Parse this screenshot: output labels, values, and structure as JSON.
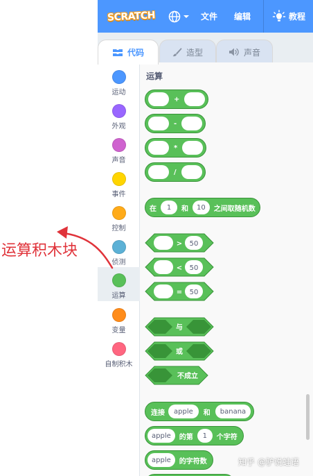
{
  "menubar": {
    "logo": "SCRATCH",
    "file": "文件",
    "edit": "编辑",
    "tutorial": "教程"
  },
  "tabs": {
    "code": "代码",
    "costume": "造型",
    "sound": "声音"
  },
  "categories": [
    {
      "label": "运动",
      "color": "#4C97FF"
    },
    {
      "label": "外观",
      "color": "#9966FF"
    },
    {
      "label": "声音",
      "color": "#CF63CF"
    },
    {
      "label": "事件",
      "color": "#FFD500"
    },
    {
      "label": "控制",
      "color": "#FFAB19"
    },
    {
      "label": "侦测",
      "color": "#5CB1D6"
    },
    {
      "label": "运算",
      "color": "#59C059"
    },
    {
      "label": "变量",
      "color": "#FF8C1A"
    },
    {
      "label": "自制积木",
      "color": "#FF6680"
    }
  ],
  "palette": {
    "title": "运算",
    "arith": [
      "+",
      "-",
      "*",
      "/"
    ],
    "random": {
      "prefix": "在",
      "from": "1",
      "mid": "和",
      "to": "10",
      "suffix": "之间取随机数"
    },
    "compare": [
      {
        "op": ">",
        "value": "50"
      },
      {
        "op": "<",
        "value": "50"
      },
      {
        "op": "=",
        "value": "50"
      }
    ],
    "logic": {
      "and": "与",
      "or": "或",
      "not": "不成立"
    },
    "join": {
      "prefix": "连接",
      "a": "apple",
      "mid": "和",
      "b": "banana"
    },
    "letter_of": {
      "a": "apple",
      "mid": "的第",
      "n": "1",
      "suffix": "个字符"
    },
    "length_of": {
      "a": "apple",
      "suffix": "的字符数"
    }
  },
  "annotation": "运算积木块",
  "watermark": "知乎 @驴说蛙语"
}
